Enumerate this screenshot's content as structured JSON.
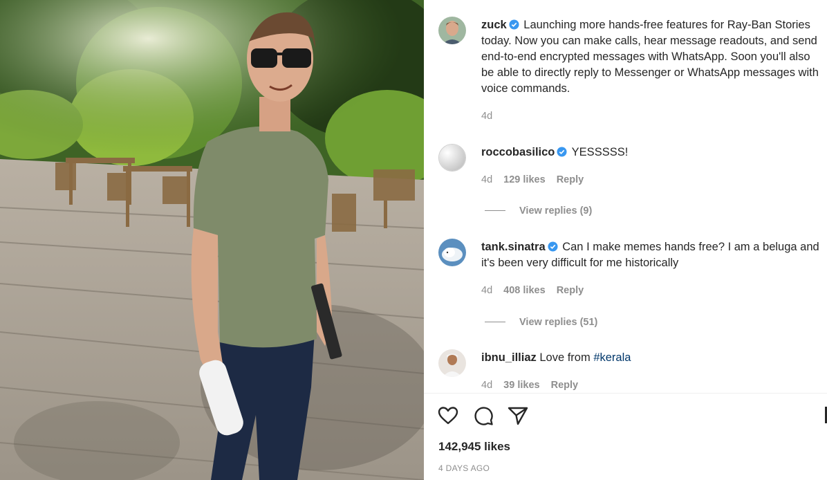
{
  "post": {
    "author": "zuck",
    "caption": "Launching more hands-free features for Ray-Ban Stories today. Now you can make calls, hear message readouts, and send end-to-end encrypted messages with WhatsApp. Soon you'll also be able to directly reply to Messenger or WhatsApp messages with voice commands.",
    "age": "4d"
  },
  "comments": [
    {
      "username": "roccobasilico",
      "verified": true,
      "text": "YESSSSS!",
      "age": "4d",
      "likes": "129 likes",
      "reply_label": "Reply",
      "view_replies": "View replies (9)"
    },
    {
      "username": "tank.sinatra",
      "verified": true,
      "text": "Can I make memes hands free? I am a beluga and it's been very difficult for me historically",
      "age": "4d",
      "likes": "408 likes",
      "reply_label": "Reply",
      "view_replies": "View replies (51)"
    },
    {
      "username": "ibnu_illiaz",
      "verified": false,
      "text": "Love from ",
      "hashtag": "#kerala",
      "age": "4d",
      "likes": "39 likes",
      "reply_label": "Reply"
    }
  ],
  "actions": {
    "like_icon": "heart-icon",
    "comment_icon": "comment-icon",
    "share_icon": "paper-plane-icon"
  },
  "stats": {
    "likes": "142,945 likes",
    "time_ago": "4 DAYS AGO"
  },
  "colors": {
    "verified_blue": "#3897f0",
    "text_primary": "#262626",
    "text_secondary": "#8e8e8e",
    "hashtag": "#00376b"
  }
}
